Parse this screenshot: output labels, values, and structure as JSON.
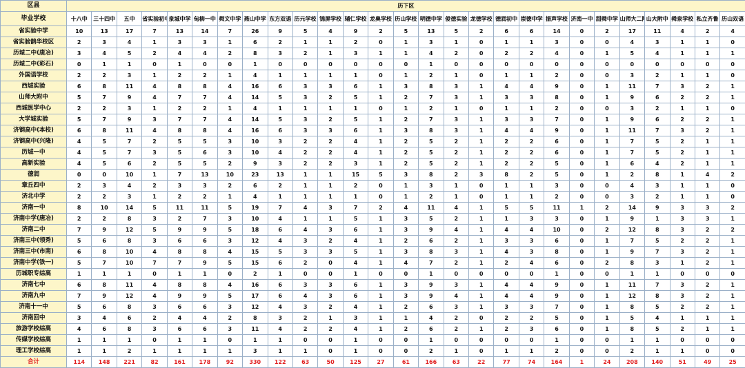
{
  "header": {
    "region_label": "区县",
    "district": "历下区",
    "school_label": "毕业学校"
  },
  "columns": [
    "十八中",
    "三十四中",
    "五中",
    "省实验初中",
    "泉城中学",
    "甸柳一中",
    "舜文中学",
    "燕山中学",
    "东方双语",
    "历元学校",
    "锦屏学校",
    "辅仁学校",
    "龙奥学校",
    "历山学校",
    "明德中学",
    "俊德实验",
    "龙德学校",
    "德润初中",
    "崇德中学",
    "振声学校",
    "济南一中",
    "甜舜中学",
    "山师大二附中",
    "山大附中",
    "舜泉学校",
    "私立齐鲁",
    "历山双语"
  ],
  "rows": [
    {
      "school": "省实验中学",
      "values": [
        10,
        13,
        17,
        7,
        13,
        14,
        7,
        26,
        9,
        5,
        4,
        9,
        2,
        5,
        13,
        5,
        2,
        6,
        6,
        14,
        0,
        2,
        17,
        11,
        4,
        2,
        4
      ]
    },
    {
      "school": "省实验鹊华校区",
      "values": [
        2,
        3,
        4,
        1,
        3,
        3,
        1,
        6,
        2,
        1,
        1,
        2,
        0,
        1,
        3,
        1,
        0,
        1,
        1,
        3,
        0,
        0,
        4,
        3,
        1,
        1,
        0
      ]
    },
    {
      "school": "历城二中(唐冶)",
      "values": [
        3,
        4,
        5,
        2,
        4,
        4,
        2,
        8,
        3,
        2,
        1,
        3,
        1,
        1,
        4,
        2,
        0,
        2,
        2,
        4,
        0,
        1,
        5,
        4,
        1,
        1,
        1
      ]
    },
    {
      "school": "历城二中(彩石)",
      "values": [
        0,
        1,
        1,
        0,
        1,
        0,
        0,
        1,
        0,
        0,
        0,
        0,
        0,
        0,
        1,
        0,
        0,
        0,
        0,
        0,
        0,
        0,
        0,
        0,
        0,
        0,
        0
      ]
    },
    {
      "school": "外国语学校",
      "values": [
        2,
        2,
        3,
        1,
        2,
        2,
        1,
        4,
        1,
        1,
        1,
        1,
        0,
        1,
        2,
        1,
        0,
        1,
        1,
        2,
        0,
        0,
        3,
        2,
        1,
        1,
        0
      ]
    },
    {
      "school": "西城实验",
      "values": [
        6,
        8,
        11,
        4,
        8,
        8,
        4,
        16,
        6,
        3,
        3,
        6,
        1,
        3,
        8,
        3,
        1,
        4,
        4,
        9,
        0,
        1,
        11,
        7,
        3,
        2,
        1
      ]
    },
    {
      "school": "山师大附中",
      "values": [
        5,
        7,
        9,
        4,
        7,
        7,
        4,
        14,
        5,
        3,
        2,
        5,
        1,
        2,
        7,
        3,
        1,
        3,
        3,
        8,
        0,
        1,
        9,
        6,
        2,
        2,
        1
      ]
    },
    {
      "school": "西城医学中心",
      "values": [
        2,
        2,
        3,
        1,
        2,
        2,
        1,
        4,
        1,
        1,
        1,
        1,
        0,
        1,
        2,
        1,
        0,
        1,
        1,
        2,
        0,
        0,
        3,
        2,
        1,
        1,
        0
      ]
    },
    {
      "school": "大学城实验",
      "values": [
        5,
        7,
        9,
        3,
        7,
        7,
        4,
        14,
        5,
        3,
        2,
        5,
        1,
        2,
        7,
        3,
        1,
        3,
        3,
        7,
        0,
        1,
        9,
        6,
        2,
        2,
        1
      ]
    },
    {
      "school": "济钢高中(本校)",
      "values": [
        6,
        8,
        11,
        4,
        8,
        8,
        4,
        16,
        6,
        3,
        3,
        6,
        1,
        3,
        8,
        3,
        1,
        4,
        4,
        9,
        0,
        1,
        11,
        7,
        3,
        2,
        1
      ]
    },
    {
      "school": "济钢高中(兴隆)",
      "values": [
        4,
        5,
        7,
        2,
        5,
        5,
        3,
        10,
        3,
        2,
        2,
        4,
        1,
        2,
        5,
        2,
        1,
        2,
        2,
        6,
        0,
        1,
        7,
        5,
        2,
        1,
        1
      ]
    },
    {
      "school": "历城一中",
      "values": [
        4,
        5,
        7,
        3,
        5,
        6,
        3,
        10,
        4,
        2,
        2,
        4,
        1,
        2,
        5,
        2,
        1,
        2,
        2,
        6,
        0,
        1,
        7,
        5,
        2,
        1,
        1
      ]
    },
    {
      "school": "高新实验",
      "values": [
        4,
        5,
        6,
        2,
        5,
        5,
        2,
        9,
        3,
        2,
        2,
        3,
        1,
        2,
        5,
        2,
        1,
        2,
        2,
        5,
        0,
        1,
        6,
        4,
        2,
        1,
        1
      ]
    },
    {
      "school": "德润",
      "values": [
        0,
        0,
        10,
        1,
        7,
        13,
        10,
        23,
        13,
        1,
        1,
        15,
        5,
        3,
        8,
        2,
        3,
        8,
        2,
        5,
        0,
        1,
        2,
        8,
        1,
        4,
        2
      ]
    },
    {
      "school": "章丘四中",
      "values": [
        2,
        3,
        4,
        2,
        3,
        3,
        2,
        6,
        2,
        1,
        1,
        2,
        0,
        1,
        3,
        1,
        0,
        1,
        1,
        3,
        0,
        0,
        4,
        3,
        1,
        1,
        0
      ]
    },
    {
      "school": "济北中学",
      "values": [
        2,
        2,
        3,
        1,
        2,
        2,
        1,
        4,
        1,
        1,
        1,
        1,
        0,
        1,
        2,
        1,
        0,
        1,
        1,
        2,
        0,
        0,
        3,
        2,
        1,
        1,
        0
      ]
    },
    {
      "school": "济南一中",
      "values": [
        8,
        10,
        14,
        5,
        11,
        11,
        5,
        19,
        7,
        4,
        3,
        7,
        2,
        4,
        11,
        4,
        1,
        5,
        5,
        11,
        1,
        2,
        14,
        9,
        3,
        3,
        2
      ]
    },
    {
      "school": "济南中学(唐冶)",
      "values": [
        2,
        2,
        8,
        3,
        2,
        7,
        3,
        10,
        4,
        1,
        1,
        5,
        1,
        3,
        5,
        2,
        1,
        1,
        3,
        3,
        0,
        1,
        9,
        1,
        3,
        3,
        1
      ]
    },
    {
      "school": "济南二中",
      "values": [
        7,
        9,
        12,
        5,
        9,
        9,
        5,
        18,
        6,
        4,
        3,
        6,
        1,
        3,
        9,
        4,
        1,
        4,
        4,
        10,
        0,
        2,
        12,
        8,
        3,
        2,
        2
      ]
    },
    {
      "school": "济南三中(领秀)",
      "values": [
        5,
        6,
        8,
        3,
        6,
        6,
        3,
        12,
        4,
        3,
        2,
        4,
        1,
        2,
        6,
        2,
        1,
        3,
        3,
        6,
        0,
        1,
        7,
        5,
        2,
        2,
        1
      ]
    },
    {
      "school": "济南三中(市南)",
      "values": [
        6,
        8,
        10,
        4,
        8,
        8,
        4,
        15,
        5,
        3,
        3,
        5,
        1,
        3,
        8,
        3,
        1,
        4,
        3,
        8,
        0,
        1,
        9,
        7,
        3,
        2,
        1
      ]
    },
    {
      "school": "济南中学(铁一)",
      "values": [
        5,
        7,
        10,
        7,
        7,
        9,
        5,
        15,
        6,
        2,
        0,
        4,
        1,
        4,
        7,
        2,
        1,
        2,
        4,
        6,
        0,
        2,
        8,
        3,
        1,
        2,
        1
      ]
    },
    {
      "school": "历城职专综高",
      "values": [
        1,
        1,
        1,
        0,
        1,
        1,
        0,
        2,
        1,
        0,
        0,
        1,
        0,
        0,
        1,
        0,
        0,
        0,
        0,
        1,
        0,
        0,
        1,
        1,
        0,
        0,
        0
      ]
    },
    {
      "school": "济南七中",
      "values": [
        6,
        8,
        11,
        4,
        8,
        8,
        4,
        16,
        6,
        3,
        3,
        6,
        1,
        3,
        9,
        3,
        1,
        4,
        4,
        9,
        0,
        1,
        11,
        7,
        3,
        2,
        1
      ]
    },
    {
      "school": "济南九中",
      "values": [
        7,
        9,
        12,
        4,
        9,
        9,
        5,
        17,
        6,
        4,
        3,
        6,
        1,
        3,
        9,
        4,
        1,
        4,
        4,
        9,
        0,
        1,
        12,
        8,
        3,
        2,
        1
      ]
    },
    {
      "school": "济南十一中",
      "values": [
        5,
        6,
        8,
        3,
        6,
        6,
        3,
        12,
        4,
        3,
        2,
        4,
        1,
        2,
        6,
        3,
        1,
        3,
        3,
        7,
        0,
        1,
        8,
        5,
        2,
        2,
        1
      ]
    },
    {
      "school": "济南回中",
      "values": [
        3,
        4,
        6,
        2,
        4,
        4,
        2,
        8,
        3,
        2,
        1,
        3,
        1,
        1,
        4,
        2,
        0,
        2,
        2,
        5,
        0,
        1,
        5,
        4,
        1,
        1,
        1
      ]
    },
    {
      "school": "旅游学校综高",
      "values": [
        4,
        6,
        8,
        3,
        6,
        6,
        3,
        11,
        4,
        2,
        2,
        4,
        1,
        2,
        6,
        2,
        1,
        2,
        3,
        6,
        0,
        1,
        8,
        5,
        2,
        1,
        1
      ]
    },
    {
      "school": "传媒学校综高",
      "values": [
        1,
        1,
        1,
        0,
        1,
        1,
        0,
        1,
        1,
        0,
        0,
        1,
        0,
        0,
        1,
        0,
        0,
        0,
        0,
        1,
        0,
        0,
        1,
        1,
        0,
        0,
        0
      ]
    },
    {
      "school": "理工学校综高",
      "values": [
        1,
        1,
        2,
        1,
        1,
        1,
        1,
        3,
        1,
        1,
        0,
        1,
        0,
        0,
        2,
        1,
        0,
        1,
        1,
        2,
        0,
        0,
        2,
        1,
        1,
        0,
        0
      ]
    }
  ],
  "total": {
    "label": "合计",
    "values": [
      114,
      148,
      221,
      82,
      161,
      178,
      92,
      330,
      122,
      63,
      50,
      125,
      27,
      61,
      166,
      63,
      22,
      77,
      74,
      164,
      1,
      24,
      208,
      140,
      51,
      49,
      25
    ]
  },
  "colors": {
    "header_bg": "#fdf6c9",
    "district_bg": "#fdf6c9",
    "border": "#9bb0c8",
    "total_text": "#e02020"
  }
}
